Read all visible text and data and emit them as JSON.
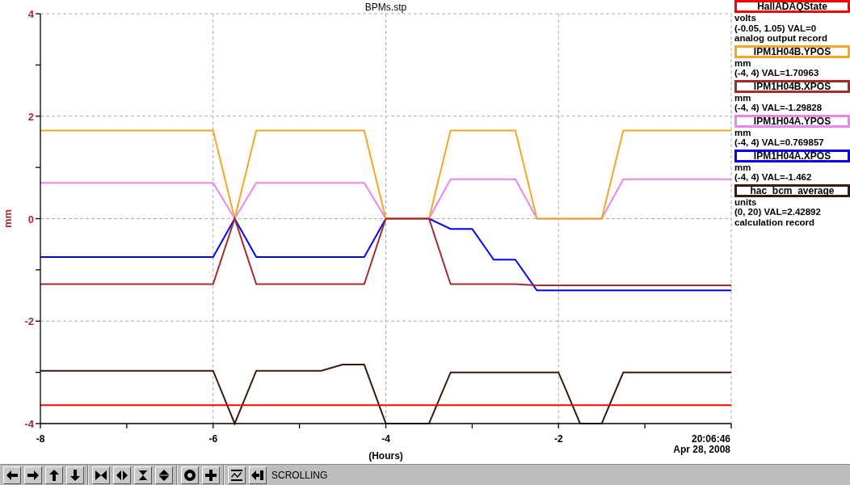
{
  "chart": {
    "chart_data": {
      "type": "line",
      "title": "BPMs.stp",
      "xlabel": "(Hours)",
      "ylabel": "mm",
      "x": [
        -8,
        -7.75,
        -7.5,
        -7.25,
        -7,
        -6.75,
        -6.5,
        -6.25,
        -6,
        -5.75,
        -5.5,
        -5.25,
        -5,
        -4.75,
        -4.5,
        -4.25,
        -4,
        -3.75,
        -3.5,
        -3.25,
        -3,
        -2.75,
        -2.5,
        -2.25,
        -2,
        -1.75,
        -1.5,
        -1.25,
        -1,
        -0.75,
        -0.5,
        -0.25,
        0
      ],
      "series": [
        {
          "name": "HallADAQState",
          "color": "#ff0000",
          "values": [
            -3.64,
            -3.64,
            -3.64,
            -3.64,
            -3.64,
            -3.64,
            -3.64,
            -3.64,
            -3.64,
            -3.64,
            -3.64,
            -3.64,
            -3.64,
            -3.64,
            -3.64,
            -3.64,
            -3.64,
            -3.64,
            -3.64,
            -3.64,
            -3.64,
            -3.64,
            -3.64,
            -3.64,
            -3.64,
            -3.64,
            -3.64,
            -3.64,
            -3.64,
            -3.64,
            -3.64,
            -3.64,
            -3.64
          ]
        },
        {
          "name": "IPM1H04B.YPOS",
          "color": "#f5a623",
          "values": [
            1.72,
            1.72,
            1.72,
            1.72,
            1.72,
            1.72,
            1.72,
            1.72,
            1.72,
            0,
            1.72,
            1.72,
            1.72,
            1.72,
            1.72,
            1.72,
            0,
            0,
            0,
            1.72,
            1.72,
            1.72,
            1.72,
            0,
            0,
            0,
            0,
            1.72,
            1.72,
            1.72,
            1.72,
            1.72,
            1.72
          ]
        },
        {
          "name": "IPM1H04B.XPOS",
          "color": "#a52a2a",
          "values": [
            -1.28,
            -1.28,
            -1.28,
            -1.28,
            -1.28,
            -1.28,
            -1.28,
            -1.28,
            -1.28,
            0,
            -1.28,
            -1.28,
            -1.28,
            -1.28,
            -1.28,
            -1.28,
            0,
            0,
            0,
            -1.28,
            -1.28,
            -1.28,
            -1.28,
            -1.3,
            -1.3,
            -1.3,
            -1.3,
            -1.3,
            -1.3,
            -1.3,
            -1.3,
            -1.3,
            -1.3
          ]
        },
        {
          "name": "IPM1H04A.YPOS",
          "color": "#ee82ee",
          "values": [
            0.7,
            0.7,
            0.7,
            0.7,
            0.7,
            0.7,
            0.7,
            0.7,
            0.7,
            0,
            0.7,
            0.7,
            0.7,
            0.7,
            0.7,
            0.7,
            0,
            0,
            0,
            0.77,
            0.77,
            0.77,
            0.77,
            0,
            0,
            0,
            0,
            0.77,
            0.77,
            0.77,
            0.77,
            0.77,
            0.77
          ]
        },
        {
          "name": "IPM1H04A.XPOS",
          "color": "#0000ff",
          "values": [
            -0.75,
            -0.75,
            -0.75,
            -0.75,
            -0.75,
            -0.75,
            -0.75,
            -0.75,
            -0.75,
            0,
            -0.75,
            -0.75,
            -0.75,
            -0.75,
            -0.75,
            -0.75,
            0,
            0,
            0,
            -0.2,
            -0.2,
            -0.8,
            -0.8,
            -1.4,
            -1.4,
            -1.4,
            -1.4,
            -1.4,
            -1.4,
            -1.4,
            -1.4,
            -1.4,
            -1.4
          ]
        },
        {
          "name": "hac_bcm_average",
          "color": "#3a1a0e",
          "values": [
            -2.97,
            -2.97,
            -2.97,
            -2.97,
            -2.97,
            -2.97,
            -2.97,
            -2.97,
            -2.97,
            -4,
            -2.97,
            -2.97,
            -2.97,
            -2.97,
            -2.85,
            -2.85,
            -4,
            -4,
            -4,
            -3,
            -3,
            -3,
            -3,
            -3,
            -3,
            -4,
            -4,
            -3,
            -3,
            -3,
            -3,
            -3,
            -3
          ]
        }
      ],
      "grid": true,
      "xlim": [
        -8,
        0
      ],
      "ylim": [
        -4,
        4
      ],
      "xticks": [
        -8,
        -6,
        -4,
        -2
      ],
      "yticks": [
        -4,
        -2,
        0,
        2,
        4
      ]
    },
    "time": "20:06:46",
    "date": "Apr 28, 2008"
  },
  "legend": [
    {
      "lines": [
        "volts",
        "(-0.05, 1.05) VAL=0",
        "analog output record"
      ]
    },
    {
      "lines": [
        "mm",
        "(-4, 4) VAL=1.70963"
      ]
    },
    {
      "lines": [
        "mm",
        "(-4, 4) VAL=-1.29828"
      ]
    },
    {
      "lines": [
        "mm",
        "(-4, 4) VAL=0.769857"
      ]
    },
    {
      "lines": [
        "mm",
        "(-4, 4) VAL=-1.462"
      ]
    },
    {
      "lines": [
        "units",
        "(0, 20) VAL=2.42892",
        "calculation record"
      ]
    }
  ],
  "toolbar": {
    "status": "SCROLLING"
  }
}
